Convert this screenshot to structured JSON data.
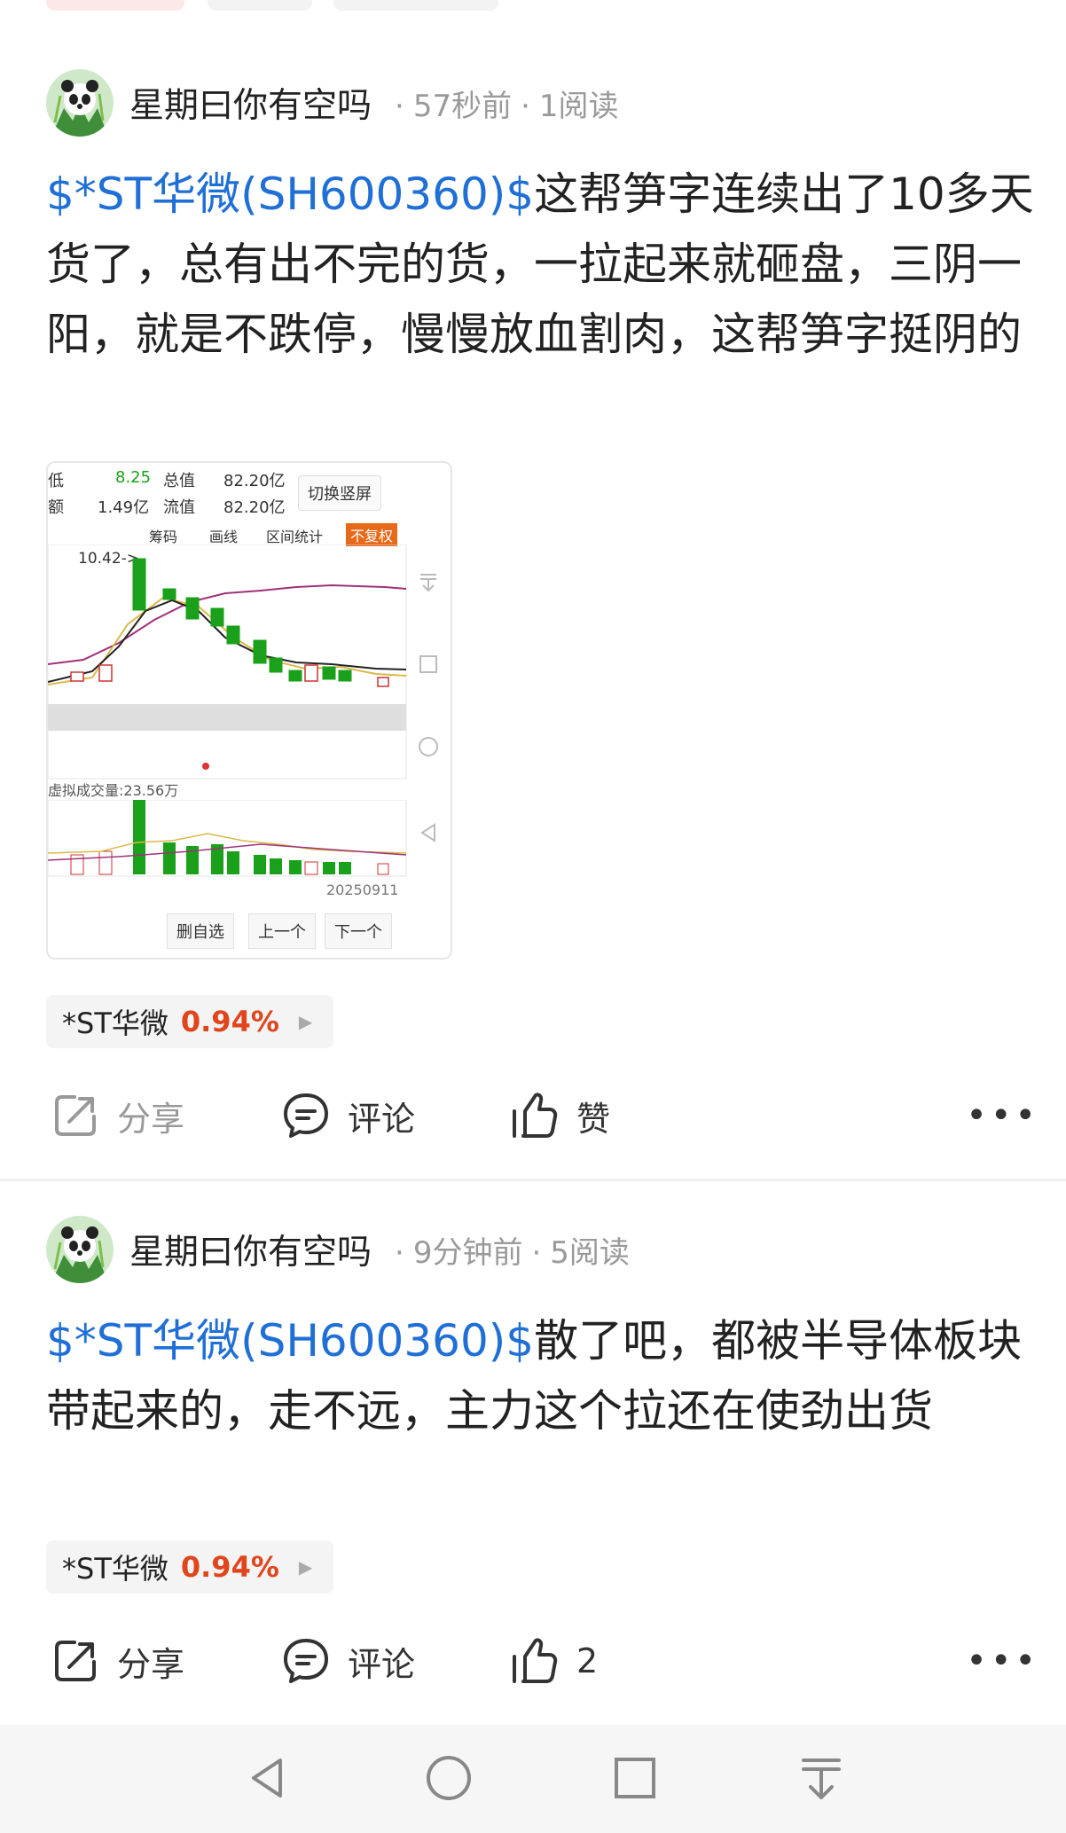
{
  "posts": [
    {
      "author": "星期曰你有空吗",
      "time": "57秒前",
      "reads": "1阅读",
      "stock_link": "$*ST华微(SH600360)$",
      "text": "这帮笋字连续出了10多天货了，总有出不完的货，一拉起来就砸盘，三阴一阳，就是不跌停，慢慢放血割肉，这帮笋字挺阴的",
      "stock_chip": {
        "name": "*ST华微",
        "pct": "0.94%"
      },
      "actions": {
        "share": "分享",
        "comment": "评论",
        "like": "赞"
      }
    },
    {
      "author": "星期曰你有空吗",
      "time": "9分钟前",
      "reads": "5阅读",
      "stock_link": "$*ST华微(SH600360)$",
      "text": "散了吧，都被半导体板块带起来的，走不远，主力这个拉还在使劲出货",
      "stock_chip": {
        "name": "*ST华微",
        "pct": "0.94%"
      },
      "actions": {
        "share": "分享",
        "comment": "评论",
        "like": "2"
      }
    }
  ],
  "screenshot": {
    "low_label": "低",
    "low_value": "8.25",
    "mcap_label": "总值",
    "mcap_value": "82.20亿",
    "amount_label": "额",
    "amount_value": "1.49亿",
    "float_label": "流值",
    "float_value": "82.20亿",
    "switch_btn": "切换竖屏",
    "tabs": [
      "筹码",
      "画线",
      "区间统计",
      "不复权"
    ],
    "high_marker": "10.42->",
    "volume_label": "虚拟成交量:23.56万",
    "date": "20250911",
    "buttons": [
      "删自选",
      "上一个",
      "下一个"
    ]
  },
  "more_icon": "more-dots-icon",
  "colors": {
    "link": "#1f6fd6",
    "pct": "#e0451c",
    "candle_green": "#1aa01a"
  }
}
